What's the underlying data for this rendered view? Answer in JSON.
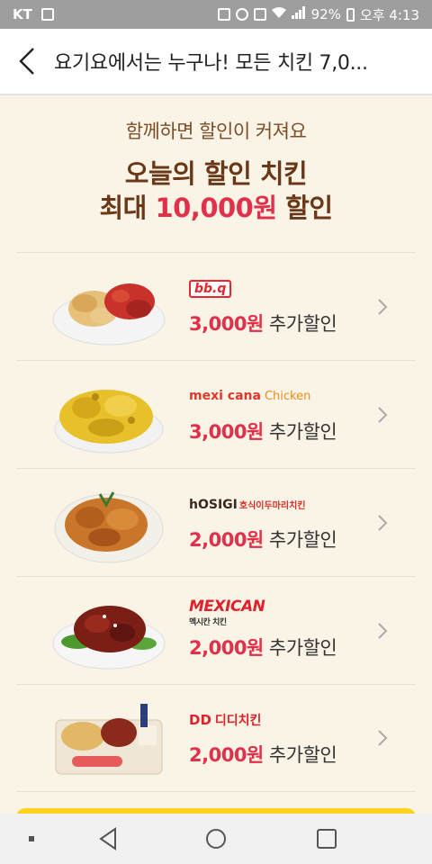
{
  "status_bar": {
    "carrier": "KT",
    "battery": "92%",
    "time": "오후 4:13"
  },
  "header": {
    "title": "요기요에서는 누구나! 모든 치킨 7,0..."
  },
  "promo": {
    "subtitle": "함께하면 할인이 커져요",
    "title_line1": "오늘의 할인 치킨",
    "title_line2_prefix": "최대 ",
    "title_line2_highlight": "10,000원",
    "title_line2_suffix": " 할인"
  },
  "items": [
    {
      "brand": "bb.q",
      "brand_sub": "",
      "amount": "3,000원",
      "suffix": " 추가할인"
    },
    {
      "brand": "mexi cana",
      "brand_sub": "Chicken",
      "amount": "3,000원",
      "suffix": " 추가할인"
    },
    {
      "brand": "hOSIGI",
      "brand_sub": "호식이두마리치킨",
      "amount": "2,000원",
      "suffix": " 추가할인"
    },
    {
      "brand": "MEXICAN",
      "brand_sub": "멕시칸 치킨",
      "amount": "2,000원",
      "suffix": " 추가할인"
    },
    {
      "brand": "DD",
      "brand_sub": "디디치킨",
      "amount": "2,000원",
      "suffix": " 추가할인"
    }
  ],
  "colors": {
    "accent": "#e0304a",
    "brown": "#6a3718",
    "background": "#f9f4e6",
    "footer_yellow": "#ffd21f"
  }
}
